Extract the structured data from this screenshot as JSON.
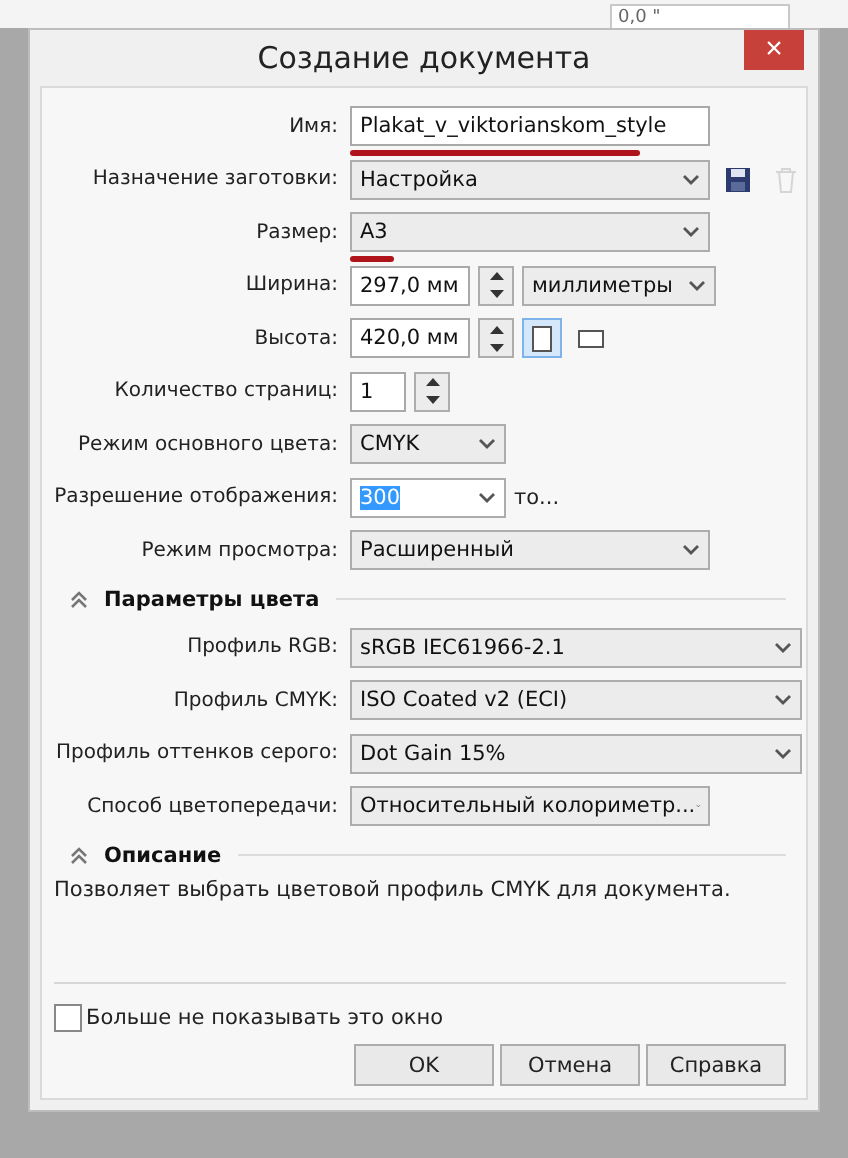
{
  "background": {
    "field_value": "0,0 \""
  },
  "window": {
    "title": "Создание документа",
    "close": "×"
  },
  "fields": [
    {
      "label": "Имя:",
      "kind": "text",
      "value": "Plakat_v_viktorianskom_style",
      "marked": true
    },
    {
      "label": "Назначение заготовки:",
      "kind": "preset",
      "value": "Настройка",
      "save_enabled": true,
      "delete_enabled": false
    },
    {
      "label": "Размер:",
      "kind": "combo",
      "value": "A3",
      "marked": true
    },
    {
      "label": "Ширина:",
      "kind": "spin-unit",
      "value": "297,0 мм",
      "unit": "миллиметры"
    },
    {
      "label": "Высота:",
      "kind": "spin-orient",
      "value": "420,0 мм",
      "portrait_selected": true
    },
    {
      "label": "Количество страниц:",
      "kind": "spin-small",
      "value": "1"
    },
    {
      "label": "Режим основного цвета:",
      "kind": "combo-short",
      "value": "CMYK"
    },
    {
      "label": "Разрешение отображения:",
      "kind": "combo-selected",
      "value": "300",
      "suffix": "то..."
    },
    {
      "label": "Режим просмотра:",
      "kind": "combo",
      "value": "Расширенный"
    }
  ],
  "color_section": {
    "title": "Параметры цвета",
    "expanded": true,
    "fields": [
      {
        "label": "Профиль RGB:",
        "kind": "combo-full",
        "value": "sRGB IEC61966-2.1"
      },
      {
        "label": "Профиль CMYK:",
        "kind": "combo-full",
        "value": "ISO Coated v2 (ECI)"
      },
      {
        "label": "Профиль оттенков серого:",
        "kind": "combo-full",
        "value": "Dot Gain 15%"
      },
      {
        "label": "Способ цветопередачи:",
        "kind": "combo",
        "value": "Относительный колориметр..."
      }
    ]
  },
  "description_section": {
    "title": "Описание",
    "expanded": true,
    "text": "Позволяет выбрать цветовой профиль CMYK для документа."
  },
  "dont_show": {
    "label": "Больше не показывать это окно",
    "checked": false
  },
  "buttons": [
    "OK",
    "Отмена",
    "Справка"
  ]
}
